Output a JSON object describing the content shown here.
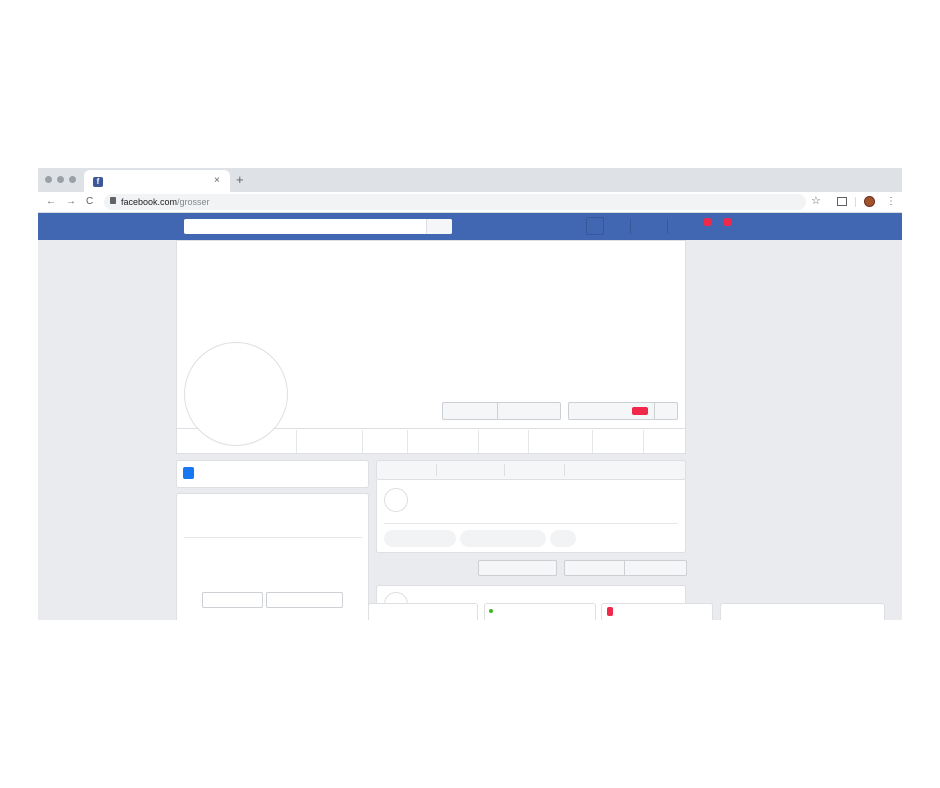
{
  "browser": {
    "tab_close": "×",
    "new_tab": "+",
    "favicon_letter": "f",
    "nav": {
      "back": "←",
      "forward": "→",
      "reload": "C"
    },
    "url": {
      "host": "facebook.com",
      "path": "/grosser"
    },
    "bookmark_icon": "☆",
    "menu_icon": "⋮"
  },
  "colors": {
    "facebook_blue": "#4267b2",
    "notification_red": "#f02849",
    "page_bg": "#e9ebee",
    "online_green": "#42b72a"
  },
  "icons": [
    "facebook-favicon-icon",
    "lock-icon",
    "star-icon",
    "extension-icon",
    "kebab-menu-icon"
  ]
}
